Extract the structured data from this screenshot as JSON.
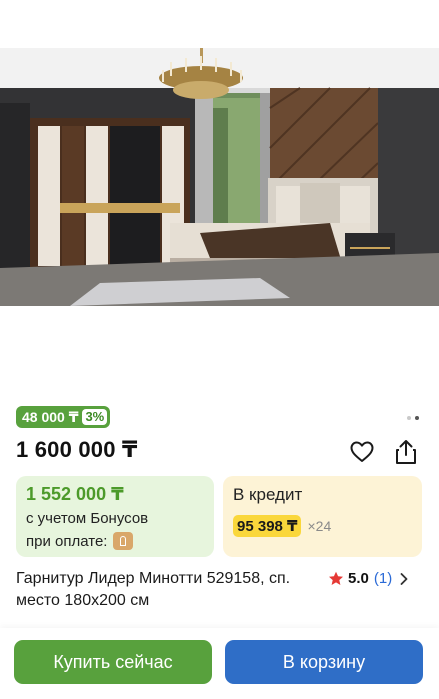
{
  "product": {
    "bonus_badge": {
      "price": "48 000 ₸",
      "percent": "3%"
    },
    "gallery": {
      "total": 2,
      "active_index": 1
    },
    "price": "1 600 000 ₸",
    "title": "Гарнитур Лидер Минотти 529158, сп. место 180x200 см",
    "rating": {
      "score": "5.0",
      "count": "(1)"
    }
  },
  "bonus_card": {
    "price": "1 552 000 ₸",
    "line1": "с учетом Бонусов",
    "line2": "при оплате:"
  },
  "credit_card": {
    "title": "В кредит",
    "monthly": "95 398 ₸",
    "months": "×24"
  },
  "actions": {
    "buy_now": "Купить сейчас",
    "add_to_cart": "В корзину"
  },
  "icons": {
    "favorite": "heart-icon",
    "share": "share-icon",
    "rating": "star-icon",
    "chevron": "chevron-right-icon",
    "payment": "kaspi-pay-icon"
  },
  "colors": {
    "green": "#58a13d",
    "blue": "#2f6ec7",
    "yellow": "#fad73b",
    "star": "#e53935",
    "rating_link": "#2b6ad6"
  }
}
